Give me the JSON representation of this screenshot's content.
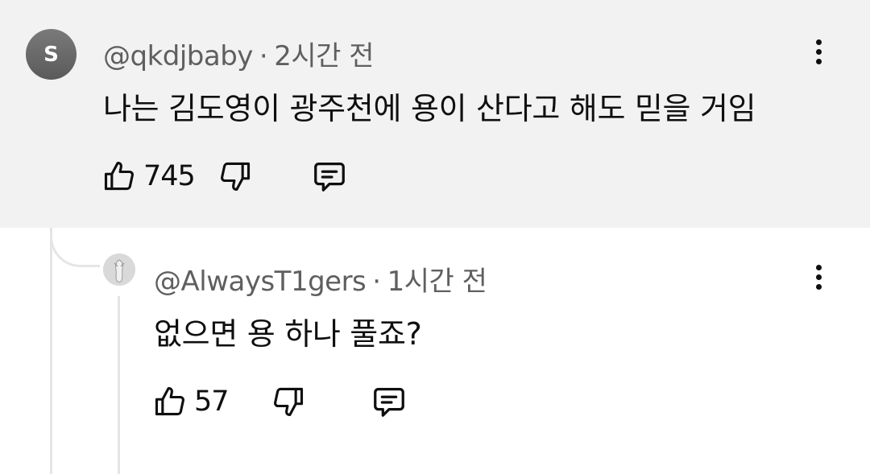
{
  "parent_comment": {
    "avatar_letter": "S",
    "author": "@qkdjbaby",
    "separator": "·",
    "time": "2시간 전",
    "text": "나는 김도영이 광주천에 용이 산다고 해도 믿을 거임",
    "likes": "745",
    "background": "#f2f2f2"
  },
  "reply_comment": {
    "author": "@AlwaysT1gers",
    "separator": "·",
    "time": "1시간 전",
    "text": "없으면 용 하나 풀죠?",
    "likes": "57"
  },
  "icons": {
    "like": "thumbs-up-icon",
    "dislike": "thumbs-down-icon",
    "reply": "comment-icon",
    "menu": "more-vertical-icon"
  }
}
